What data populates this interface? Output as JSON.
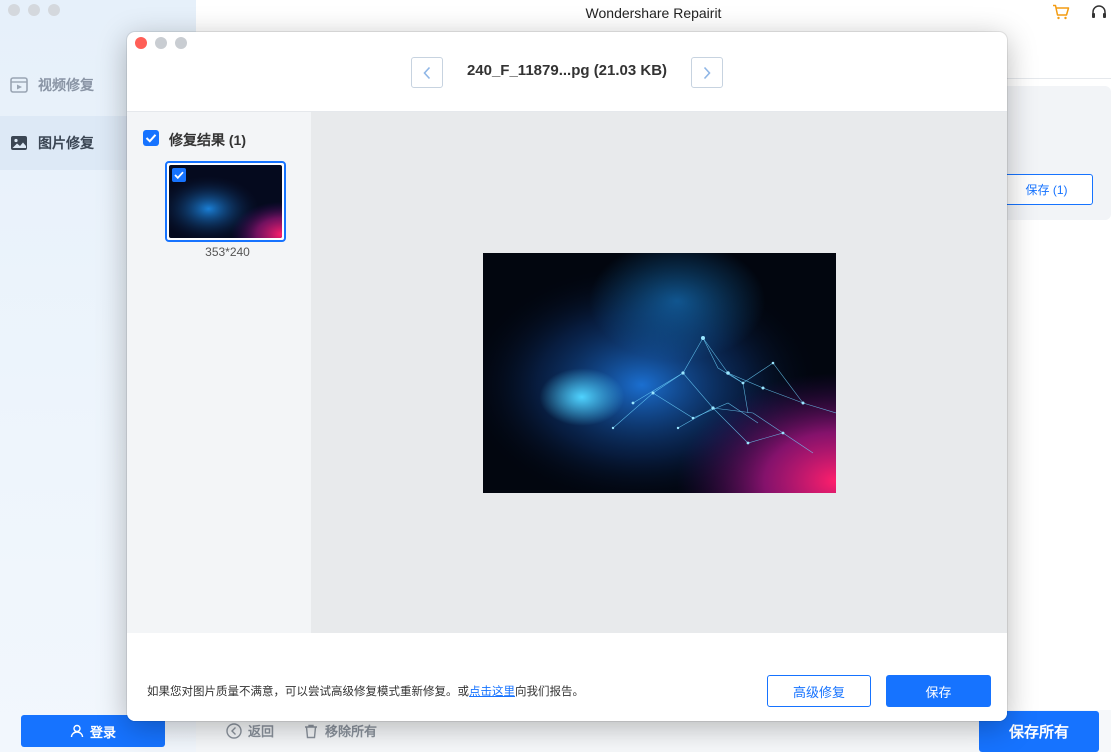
{
  "app": {
    "title": "Wondershare Repairit"
  },
  "sidebar": {
    "items": [
      {
        "label": "视频修复",
        "icon": "video-icon"
      },
      {
        "label": "图片修复",
        "icon": "image-icon"
      }
    ],
    "login_label": "登录"
  },
  "background": {
    "save_count_label": "保存 (1)",
    "back_label": "返回",
    "remove_all_label": "移除所有",
    "save_all_label": "保存所有"
  },
  "modal": {
    "file_title": "240_F_11879...pg (21.03 KB)",
    "result_label": "修复结果 (1)",
    "thumb_size": "353*240",
    "footer_note_prefix": "如果您对图片质量不满意，可以尝试高级修复模式重新修复。或",
    "footer_note_link": "点击这里",
    "footer_note_suffix": "向我们报告。",
    "advanced_repair_label": "高级修复",
    "save_label": "保存"
  },
  "colors": {
    "accent": "#1673ff",
    "sidebar_bg": "#e6f0fa",
    "preview_bg": "#e8eaec"
  }
}
